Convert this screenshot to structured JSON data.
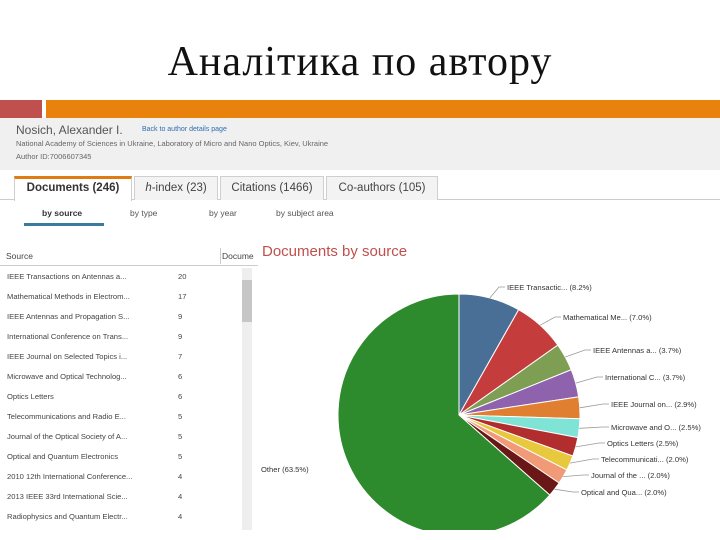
{
  "slide": {
    "title": "Аналітика по автору"
  },
  "author": {
    "name": "Nosich, Alexander I.",
    "back_link": "Back to author details page",
    "affiliation": "National Academy of Sciences in Ukraine, Laboratory of Micro and Nano Optics, Kiev, Ukraine",
    "author_id": "Author ID:7006607345"
  },
  "tabs": [
    {
      "label": "Documents (246)"
    },
    {
      "label_prefix": "h",
      "label_rest": "-index (23)"
    },
    {
      "label": "Citations (1466)"
    },
    {
      "label": "Co-authors (105)"
    }
  ],
  "subtabs": [
    {
      "label": "by source"
    },
    {
      "label": "by type"
    },
    {
      "label": "by year"
    },
    {
      "label": "by subject area"
    }
  ],
  "table": {
    "columns": [
      "Source",
      "Documents"
    ],
    "rows": [
      {
        "source": "IEEE Transactions on Antennas a...",
        "count": "20"
      },
      {
        "source": "Mathematical Methods in Electrom...",
        "count": "17"
      },
      {
        "source": "IEEE Antennas and Propagation S...",
        "count": "9"
      },
      {
        "source": "International Conference on Trans...",
        "count": "9"
      },
      {
        "source": "IEEE Journal on Selected Topics i...",
        "count": "7"
      },
      {
        "source": "Microwave and Optical Technolog...",
        "count": "6"
      },
      {
        "source": "Optics Letters",
        "count": "6"
      },
      {
        "source": "Telecommunications and Radio E...",
        "count": "5"
      },
      {
        "source": "Journal of the Optical Society of A...",
        "count": "5"
      },
      {
        "source": "Optical and Quantum Electronics",
        "count": "5"
      },
      {
        "source": "2010 12th International Conference...",
        "count": "4"
      },
      {
        "source": "2013 IEEE 33rd International Scie...",
        "count": "4"
      },
      {
        "source": "Radiophysics and Quantum Electr...",
        "count": "4"
      }
    ]
  },
  "chart_data": {
    "type": "pie",
    "title": "Documents by source",
    "slices": [
      {
        "label": "IEEE Transactic... (8.2%)",
        "value": 8.2,
        "color": "#4a6f97"
      },
      {
        "label": "Mathematical Me... (7.0%)",
        "value": 7.0,
        "color": "#c43c3c"
      },
      {
        "label": "IEEE Antennas a... (3.7%)",
        "value": 3.7,
        "color": "#7e9e54"
      },
      {
        "label": "International C... (3.7%)",
        "value": 3.7,
        "color": "#8e62ac"
      },
      {
        "label": "IEEE Journal on... (2.9%)",
        "value": 2.9,
        "color": "#e07f30"
      },
      {
        "label": "Microwave and O... (2.5%)",
        "value": 2.5,
        "color": "#7fe3d6"
      },
      {
        "label": "Optics Letters (2.5%)",
        "value": 2.5,
        "color": "#b22e2e"
      },
      {
        "label": "Telecommunicati... (2.0%)",
        "value": 2.0,
        "color": "#e8c83c"
      },
      {
        "label": "Journal of the ... (2.0%)",
        "value": 2.0,
        "color": "#f19a78"
      },
      {
        "label": "Optical and Qua... (2.0%)",
        "value": 2.0,
        "color": "#6a1717"
      },
      {
        "label": "Other (63.5%)",
        "value": 63.5,
        "color": "#2d8a2d"
      }
    ]
  }
}
